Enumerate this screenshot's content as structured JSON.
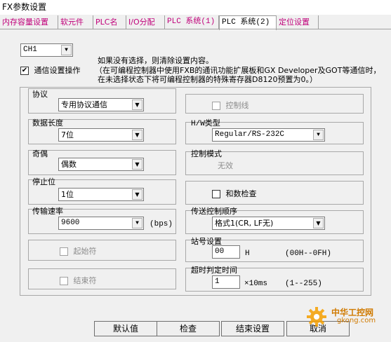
{
  "window": {
    "title": "FX参数设置"
  },
  "tabs": [
    "内存容量设置",
    "软元件",
    "PLC名",
    "I/O分配",
    "PLC 系统(1)",
    "PLC 系统(2)",
    "定位设置"
  ],
  "channel": {
    "value": "CH1"
  },
  "comm": {
    "checkbox_label": "通信设置操作",
    "checked": true,
    "note_line1": "如果没有选择，则清除设置内容。",
    "note_line2": "（在可编程控制器中使用FXB的通讯功能扩展板和GX Developer及GOT等通信时，",
    "note_line3": "在未选择状态下将可编程控制器的特殊寄存器D8120预置为0。）"
  },
  "left": {
    "protocol_label": "协议",
    "protocol_value": "专用协议通信",
    "data_length_label": "数据长度",
    "data_length_value": "7位",
    "parity_label": "奇偶",
    "parity_value": "偶数",
    "stop_bit_label": "停止位",
    "stop_bit_value": "1位",
    "baud_label": "传输速率",
    "baud_value": "9600",
    "baud_unit": "(bps)",
    "start_char_label": "起始符",
    "end_char_label": "结束符"
  },
  "right": {
    "control_line_label": "控制线",
    "hw_type_label": "H/W类型",
    "hw_type_value": "Regular/RS-232C",
    "control_mode_label": "控制模式",
    "control_mode_value": "无效",
    "checksum_label": "和数检查",
    "trans_ctrl_label": "传送控制顺序",
    "trans_ctrl_value": "格式1(CR, LF无)",
    "station_label": "站号设置",
    "station_value": "00",
    "station_unit": "H",
    "station_range": "(00H--0FH)",
    "timeout_label": "超时判定时间",
    "timeout_value": "1",
    "timeout_unit": "×10ms",
    "timeout_range": "(1--255)"
  },
  "buttons": {
    "default": "默认值",
    "check": "检查",
    "end": "结束设置",
    "cancel": "取消"
  },
  "watermark": {
    "cn": "中华工控网",
    "url": "gkong.com"
  },
  "colors": {
    "tab_text": "#c0007a",
    "disabled_text": "#8c8c8c"
  }
}
